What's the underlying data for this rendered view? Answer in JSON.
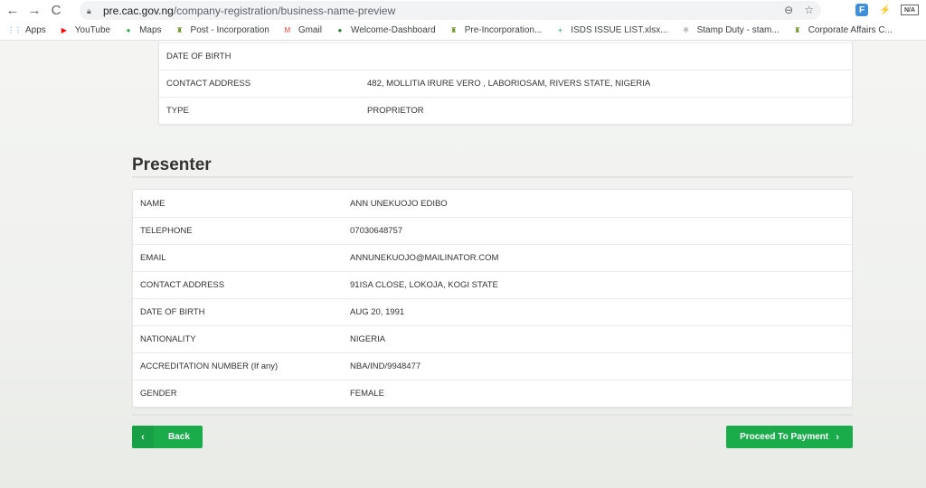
{
  "browser": {
    "url_host": "pre.cac.gov.ng",
    "url_path": "/company-registration/business-name-preview",
    "nav": {
      "back_icon": "←",
      "forward_icon": "→",
      "reload_icon": "C"
    },
    "omni_icons": {
      "zoom": "⊖",
      "star": "☆"
    },
    "extensions": {
      "ext1": "F",
      "ext2": "⚡",
      "ext3": "N/A"
    },
    "bookmarks": [
      {
        "label": "Apps",
        "icon": "apps-grid-icon",
        "glyph": "⋮⋮",
        "color": "#4285f4"
      },
      {
        "label": "YouTube",
        "icon": "youtube-icon",
        "glyph": "▶",
        "color": "#ff0000"
      },
      {
        "label": "Maps",
        "icon": "maps-pin-icon",
        "glyph": "●",
        "color": "#34a853"
      },
      {
        "label": "Post - Incorporation",
        "icon": "coat-of-arms-icon",
        "glyph": "♜",
        "color": "#6b8e23"
      },
      {
        "label": "Gmail",
        "icon": "gmail-icon",
        "glyph": "M",
        "color": "#ea4335"
      },
      {
        "label": "Welcome-Dashboard",
        "icon": "dashboard-icon",
        "glyph": "●",
        "color": "#2e7d32"
      },
      {
        "label": "Pre-Incorporation...",
        "icon": "coat-of-arms-icon",
        "glyph": "♜",
        "color": "#6b8e23"
      },
      {
        "label": "ISDS ISSUE LIST.xlsx...",
        "icon": "sheets-icon",
        "glyph": "+",
        "color": "#0f9d58"
      },
      {
        "label": "Stamp Duty - stam...",
        "icon": "stamp-duty-icon",
        "glyph": "※",
        "color": "#888888"
      },
      {
        "label": "Corporate Affairs C...",
        "icon": "coat-of-arms-icon",
        "glyph": "♜",
        "color": "#6b8e23"
      }
    ]
  },
  "proprietor_partial": {
    "rows": [
      {
        "label": "DATE OF BIRTH",
        "value": ""
      },
      {
        "label": "CONTACT ADDRESS",
        "value": "482, MOLLITIA IRURE VERO , LABORIOSAM, RIVERS STATE, NIGERIA"
      },
      {
        "label": "TYPE",
        "value": "PROPRIETOR"
      }
    ]
  },
  "presenter": {
    "title": "Presenter",
    "rows": [
      {
        "label": "NAME",
        "value": "ANN UNEKUOJO EDIBO"
      },
      {
        "label": "TELEPHONE",
        "value": "07030648757"
      },
      {
        "label": "EMAIL",
        "value": "ANNUNEKUOJO@MAILINATOR.COM"
      },
      {
        "label": "CONTACT ADDRESS",
        "value": "91ISA CLOSE, LOKOJA, KOGI STATE"
      },
      {
        "label": "DATE OF BIRTH",
        "value": "AUG 20, 1991"
      },
      {
        "label": "NATIONALITY",
        "value": "NIGERIA"
      },
      {
        "label": "ACCREDITATION NUMBER (If any)",
        "value": "NBA/IND/9948477"
      },
      {
        "label": "GENDER",
        "value": "FEMALE"
      }
    ]
  },
  "actions": {
    "back_label": "Back",
    "back_icon": "‹",
    "proceed_label": "Proceed To Payment",
    "proceed_icon": "›"
  },
  "colors": {
    "accent": "#1aab4b"
  }
}
